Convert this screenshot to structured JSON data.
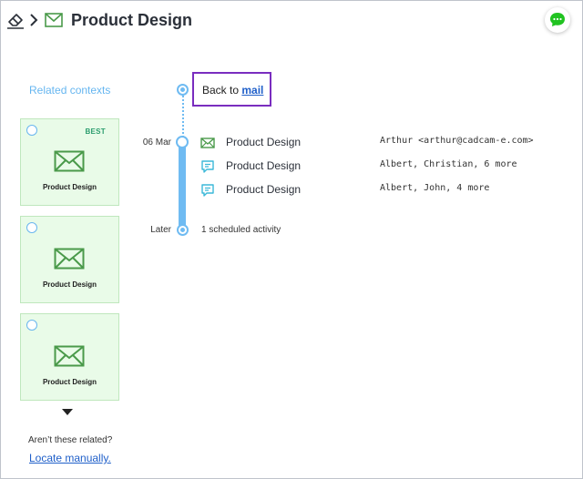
{
  "header": {
    "title": "Product Design",
    "erase_icon": "eraser-icon",
    "separator_icon": "chevron-right-icon",
    "context_icon": "mail-icon",
    "chat_icon": "chat-bubble-icon",
    "chat_color": "#21c321"
  },
  "sidebar": {
    "title": "Related contexts",
    "cards": [
      {
        "label": "Product Design",
        "badge": "BEST",
        "icon": "mail-icon"
      },
      {
        "label": "Product Design",
        "badge": "",
        "icon": "mail-icon"
      },
      {
        "label": "Product Design",
        "badge": "",
        "icon": "mail-icon"
      }
    ],
    "not_related_text": "Aren’t these related?",
    "locate_link": "Locate manually."
  },
  "timeline": {
    "back_prefix": "Back to",
    "back_link": "mail",
    "date_label": "06 Mar",
    "later_label": "Later",
    "activities": [
      {
        "type": "mail",
        "icon": "mail-icon",
        "title": "Product Design",
        "participants": "Arthur <arthur@cadcam-e.com>"
      },
      {
        "type": "chat",
        "icon": "chat-icon",
        "title": "Product Design",
        "participants": "Albert, Christian, 6 more"
      },
      {
        "type": "chat",
        "icon": "chat-icon",
        "title": "Product Design",
        "participants": "Albert, John, 4 more"
      }
    ],
    "scheduled_text": "1 scheduled activity"
  },
  "colors": {
    "accent_blue": "#6fbbf2",
    "card_bg": "#e9fbe8",
    "mail_green": "#4a9a4a",
    "highlight_purple": "#7a2dbf",
    "link_blue": "#1f5fc9"
  }
}
